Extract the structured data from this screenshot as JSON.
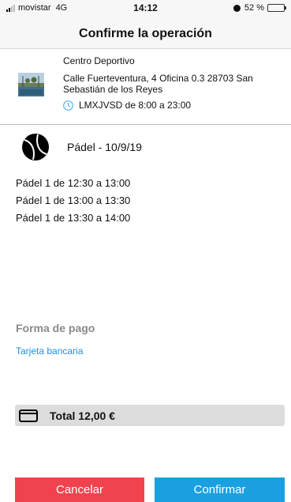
{
  "status_bar": {
    "carrier": "movistar",
    "network": "4G",
    "time": "14:12",
    "battery": "52 %",
    "battery_level": 0.52
  },
  "header": {
    "title": "Confirme la operación"
  },
  "venue": {
    "name": "Centro Deportivo",
    "address": "Calle Fuerteventura, 4 Oficina 0.3 28703 San Sebastián de los Reyes",
    "hours": "LMXJVSD de 8:00 a 23:00",
    "icon": "clock-icon"
  },
  "sport": {
    "icon": "padel-ball-icon",
    "title": "Pádel - 10/9/19"
  },
  "bookings": [
    "Pádel 1 de 12:30 a 13:00",
    "Pádel 1 de 13:00 a 13:30",
    "Pádel 1 de 13:30 a 14:00"
  ],
  "payment": {
    "title": "Forma de pago",
    "method": "Tarjeta bancaria"
  },
  "total": {
    "icon": "credit-card-icon",
    "label": "Total 12,00 €"
  },
  "actions": {
    "cancel_label": "Cancelar",
    "confirm_label": "Confirmar"
  },
  "colors": {
    "cancel": "#f0434e",
    "confirm": "#1aa0e0",
    "link": "#1e8ee6",
    "clock_icon": "#3fa6e6"
  }
}
